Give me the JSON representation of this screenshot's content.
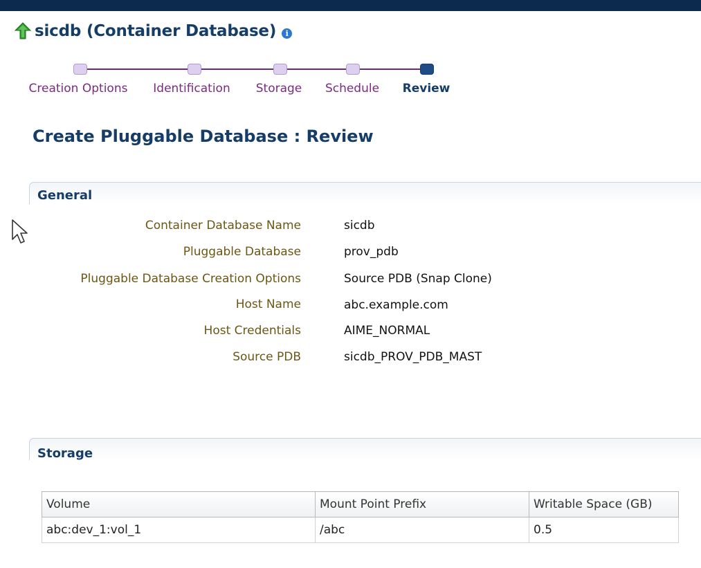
{
  "header": {
    "title": "sicdb (Container Database)",
    "info_glyph": "i"
  },
  "train": {
    "steps": [
      {
        "label": "Creation Options",
        "current": false
      },
      {
        "label": "Identification",
        "current": false
      },
      {
        "label": "Storage",
        "current": false
      },
      {
        "label": "Schedule",
        "current": false
      },
      {
        "label": "Review",
        "current": true
      }
    ]
  },
  "page_title": "Create Pluggable Database : Review",
  "general": {
    "title": "General",
    "rows": [
      {
        "label": "Container Database Name",
        "value": "sicdb"
      },
      {
        "label": "Pluggable Database",
        "value": "prov_pdb"
      },
      {
        "label": "Pluggable Database Creation Options",
        "value": "Source PDB (Snap Clone)"
      },
      {
        "label": "Host Name",
        "value": "abc.example.com"
      },
      {
        "label": "Host Credentials",
        "value": "AIME_NORMAL"
      },
      {
        "label": "Source PDB",
        "value": "sicdb_PROV_PDB_MAST"
      }
    ]
  },
  "storage": {
    "title": "Storage",
    "columns": [
      "Volume",
      "Mount Point Prefix",
      "Writable Space (GB)"
    ],
    "rows": [
      [
        "abc:dev_1:vol_1",
        "/abc",
        "0.5"
      ]
    ]
  },
  "colors": {
    "title": "#163c68",
    "label": "#6b5614",
    "train_visited": "#7a2a80",
    "topbar": "#0c2a4e"
  },
  "icons": [
    "up-arrow-icon",
    "info-icon",
    "mouse-cursor-icon"
  ]
}
